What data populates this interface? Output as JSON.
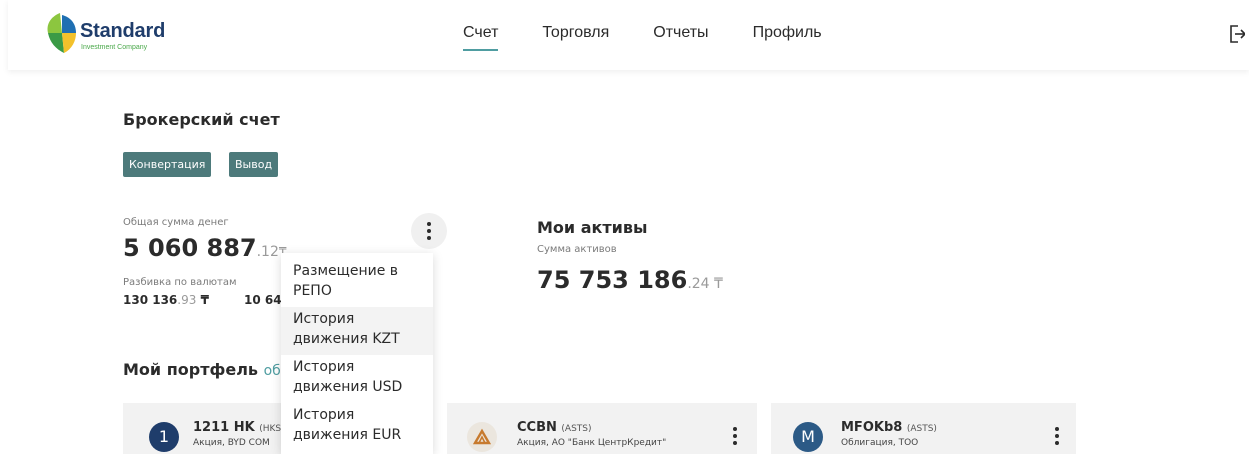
{
  "header": {
    "logo_name": "Standard",
    "logo_sub": "Investment Company",
    "nav": [
      {
        "label": "Счет",
        "active": true
      },
      {
        "label": "Торговля",
        "active": false
      },
      {
        "label": "Отчеты",
        "active": false
      },
      {
        "label": "Профиль",
        "active": false
      }
    ],
    "logout_icon": "logout-icon"
  },
  "account": {
    "title": "Брокерский счет",
    "buttons": {
      "convert": "Конвертация",
      "withdraw": "Вывод"
    },
    "total_label": "Общая сумма денег",
    "total_int": "5 060 887",
    "total_dec": ".12",
    "total_currency": "₸",
    "breakdown_label": "Разбивка по валютам",
    "breakdown_1_int": "130 136",
    "breakdown_1_dec": ".93",
    "breakdown_1_currency": "₸",
    "breakdown_2_partial": "10 64"
  },
  "assets": {
    "title": "Мои активы",
    "sum_label": "Сумма активов",
    "sum_int": "75 753 186",
    "sum_dec": ".24",
    "sum_currency": "₸"
  },
  "menu": {
    "items": [
      "Размещение в РЕПО",
      "История движения KZT",
      "История движения USD",
      "История движения EUR"
    ]
  },
  "portfolio": {
    "title": "Мой портфель",
    "update_partial": "обн",
    "cards": [
      {
        "icon_letter": "1",
        "ticker": "1211 HK",
        "exchange": "(HKS",
        "desc": "Акция, BYD COM",
        "icon_color": "#1f3d6b"
      },
      {
        "icon_letter": "",
        "ticker": "CCBN",
        "exchange": "(ASTS)",
        "desc": "Акция, АО \"Банк ЦентрКредит\"",
        "icon_color": "#e8e2d8"
      },
      {
        "icon_letter": "M",
        "ticker": "MFOKb8",
        "exchange": "(ASTS)",
        "desc": "Облигация, ТОО",
        "icon_color": "#2c5a86"
      }
    ]
  },
  "colors": {
    "accent": "#4f9da1",
    "button": "#4d7a7b",
    "logo_navy": "#1f3d6b",
    "logo_green": "#4aa84a"
  }
}
